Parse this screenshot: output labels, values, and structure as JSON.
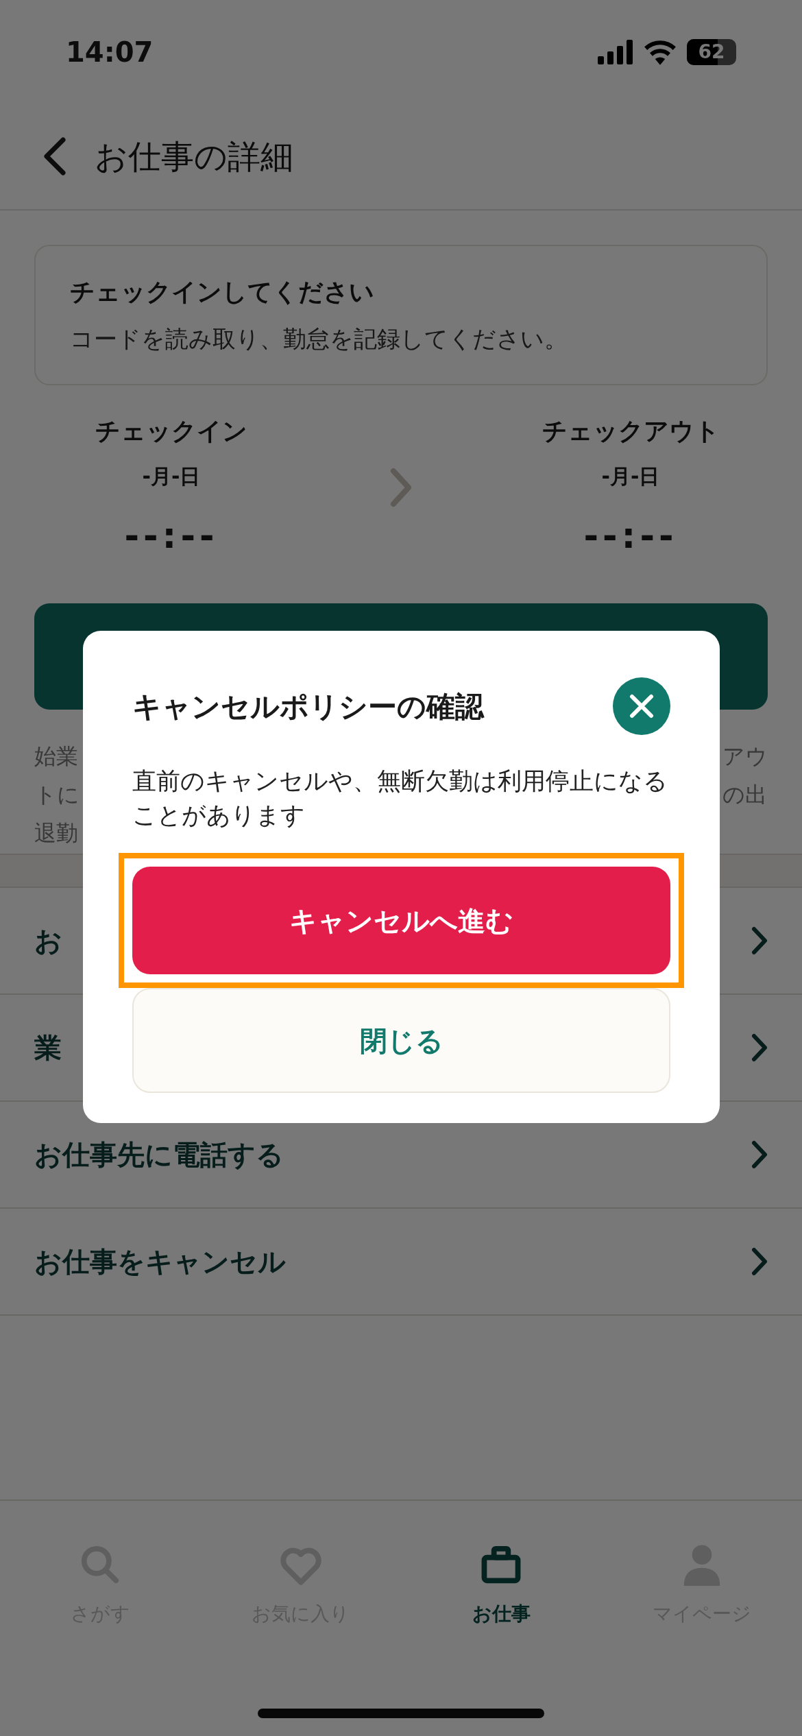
{
  "status_bar": {
    "time": "14:07",
    "battery": "62"
  },
  "header": {
    "title": "お仕事の詳細"
  },
  "notice": {
    "title": "チェックインしてください",
    "message": "コードを読み取り、勤怠を記録してください。"
  },
  "attendance": [
    {
      "label": "チェックイン",
      "date": "-月-日",
      "time": "--:--"
    },
    {
      "label": "チェックアウト",
      "date": "-月-日",
      "time": "--:--"
    }
  ],
  "note_fragments": {
    "left": [
      "始業",
      "トに",
      "退勤"
    ],
    "right": [
      "アウ",
      "の出"
    ]
  },
  "menu_items": [
    "お",
    "業",
    "お仕事先に電話する",
    "お仕事をキャンセル"
  ],
  "tab_bar": [
    {
      "label": "さがす",
      "kind": "search",
      "selected": false
    },
    {
      "label": "お気に入り",
      "kind": "heart",
      "selected": false
    },
    {
      "label": "お仕事",
      "kind": "briefcase",
      "selected": true
    },
    {
      "label": "マイページ",
      "kind": "person",
      "selected": false
    }
  ],
  "dialog": {
    "title": "キャンセルポリシーの確認",
    "message": "直前のキャンセルや、無断欠勤は利用停止になることがあります",
    "buttons": [
      {
        "label": "キャンセルへ進む",
        "kind": "primary",
        "highlighted": true
      },
      {
        "label": "閉じる",
        "kind": "secondary",
        "highlighted": false
      }
    ]
  }
}
